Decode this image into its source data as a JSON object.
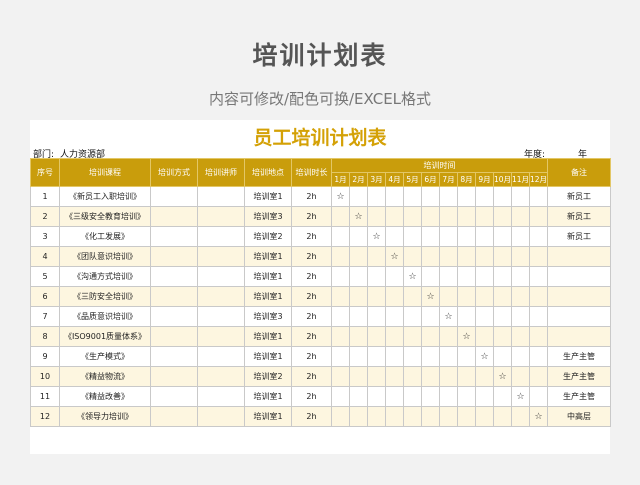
{
  "page": {
    "title": "培训计划表",
    "subtitle": "内容可修改/配色可换/EXCEL格式"
  },
  "sheet": {
    "title": "员工培训计划表",
    "dept_label": "部门:",
    "dept_value": "人力资源部",
    "year_label": "年度:",
    "year_value": "年",
    "accent_color": "#d4a106",
    "header_color": "#c99d0c"
  },
  "table": {
    "headers": {
      "no": "序号",
      "course": "培训课程",
      "method": "培训方式",
      "trainer": "培训讲师",
      "place": "培训地点",
      "duration": "培训时长",
      "time": "培训时间",
      "note": "备注"
    },
    "months": [
      "1月",
      "2月",
      "3月",
      "4月",
      "5月",
      "6月",
      "7月",
      "8月",
      "9月",
      "10月",
      "11月",
      "12月"
    ],
    "star": "☆",
    "rows": [
      {
        "no": "1",
        "course": "《新员工入职培训》",
        "method": "",
        "trainer": "",
        "place": "培训室1",
        "duration": "2h",
        "month": 1,
        "note": "新员工"
      },
      {
        "no": "2",
        "course": "《三级安全教育培训》",
        "method": "",
        "trainer": "",
        "place": "培训室3",
        "duration": "2h",
        "month": 2,
        "note": "新员工"
      },
      {
        "no": "3",
        "course": "《化工发展》",
        "method": "",
        "trainer": "",
        "place": "培训室2",
        "duration": "2h",
        "month": 3,
        "note": "新员工"
      },
      {
        "no": "4",
        "course": "《团队意识培训》",
        "method": "",
        "trainer": "",
        "place": "培训室1",
        "duration": "2h",
        "month": 4,
        "note": ""
      },
      {
        "no": "5",
        "course": "《沟通方式培训》",
        "method": "",
        "trainer": "",
        "place": "培训室1",
        "duration": "2h",
        "month": 5,
        "note": ""
      },
      {
        "no": "6",
        "course": "《三防安全培训》",
        "method": "",
        "trainer": "",
        "place": "培训室1",
        "duration": "2h",
        "month": 6,
        "note": ""
      },
      {
        "no": "7",
        "course": "《品质意识培训》",
        "method": "",
        "trainer": "",
        "place": "培训室3",
        "duration": "2h",
        "month": 7,
        "note": ""
      },
      {
        "no": "8",
        "course": "《ISO9001质量体系》",
        "method": "",
        "trainer": "",
        "place": "培训室1",
        "duration": "2h",
        "month": 8,
        "note": ""
      },
      {
        "no": "9",
        "course": "《生产模式》",
        "method": "",
        "trainer": "",
        "place": "培训室1",
        "duration": "2h",
        "month": 9,
        "note": "生产主管"
      },
      {
        "no": "10",
        "course": "《精益物流》",
        "method": "",
        "trainer": "",
        "place": "培训室2",
        "duration": "2h",
        "month": 10,
        "note": "生产主管"
      },
      {
        "no": "11",
        "course": "《精益改善》",
        "method": "",
        "trainer": "",
        "place": "培训室1",
        "duration": "2h",
        "month": 11,
        "note": "生产主管"
      },
      {
        "no": "12",
        "course": "《领导力培训》",
        "method": "",
        "trainer": "",
        "place": "培训室1",
        "duration": "2h",
        "month": 12,
        "note": "中高层"
      }
    ]
  }
}
